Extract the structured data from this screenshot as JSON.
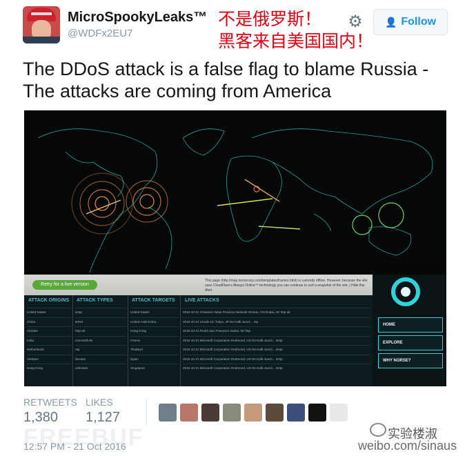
{
  "tweet": {
    "display_name": "MicroSpookyLeaks™",
    "handle": "@WDFx2EU7",
    "follow_label": "Follow",
    "text": "The DDoS attack is a false flag to blame Russia - The attacks are coming from America",
    "overlay_cn": "不是俄罗斯！\n黑客来自美国国内！",
    "retweets_label": "RETWEETS",
    "retweets": "1,380",
    "likes_label": "LIKES",
    "likes": "1,127",
    "timestamp": "12:57 PM - 21 Oct 2016"
  },
  "embedded_screenshot": {
    "retry_label": "Retry for a live version",
    "notice": "This page (http://map.norsecorp.com/templates/frames.html) is currently offline. However, because the site uses CloudFlare's Always Online™ technology you can continue to surf a snapshot of the site. | Hide this Alert",
    "headers": {
      "origins": "ATTACK ORIGINS",
      "types": "ATTACK TYPES",
      "targets": "ATTACK TARGETS",
      "live": "LIVE ATTACKS"
    },
    "origins": [
      "United States",
      "China",
      "Ukraine",
      "India",
      "Netherlands",
      "Vietnam",
      "Hong Kong"
    ],
    "types": [
      "smtp",
      "telnet",
      "http-alt",
      "microsoft-ds",
      "ntp",
      "domain",
      "unknown"
    ],
    "targets": [
      "United States",
      "United Arab Emira...",
      "Hong Kong",
      "France",
      "Thailand",
      "Spain",
      "Singapore"
    ],
    "live": [
      "2016-10-21 Chinanet Hubei Province Network Wuhan, CN Dubai, AE http-alt",
      "2016-10-21 Linode Llc Tokyo, JP De Kalb Juncti... ntp",
      "2016-10-21 Roots San Francisco Dubai, AE http",
      "2016-10-21 Microsoft Corporation Redmond, US De Kalb Juncti... smtp",
      "2016-10-21 Microsoft Corporation Redmond, US De Kalb Juncti... smtp",
      "2016-10-21 Microsoft Corporation Redmond, US De Kalb Juncti... smtp",
      "2016-10-21 Microsoft Corporation Redmond, US De Kalb Juncti... smtp"
    ],
    "nav": [
      "HOME",
      "EXPLORE",
      "WHY NORSE?"
    ]
  },
  "watermark": {
    "freebuf": "FREEBUF",
    "weibo_name": "实验楼淑",
    "weibo_url": "weibo.com/sinaus"
  },
  "colors": {
    "accent": "#1b95e0",
    "overlay_red": "#e60012",
    "map_lines": "#2fd4d9"
  }
}
